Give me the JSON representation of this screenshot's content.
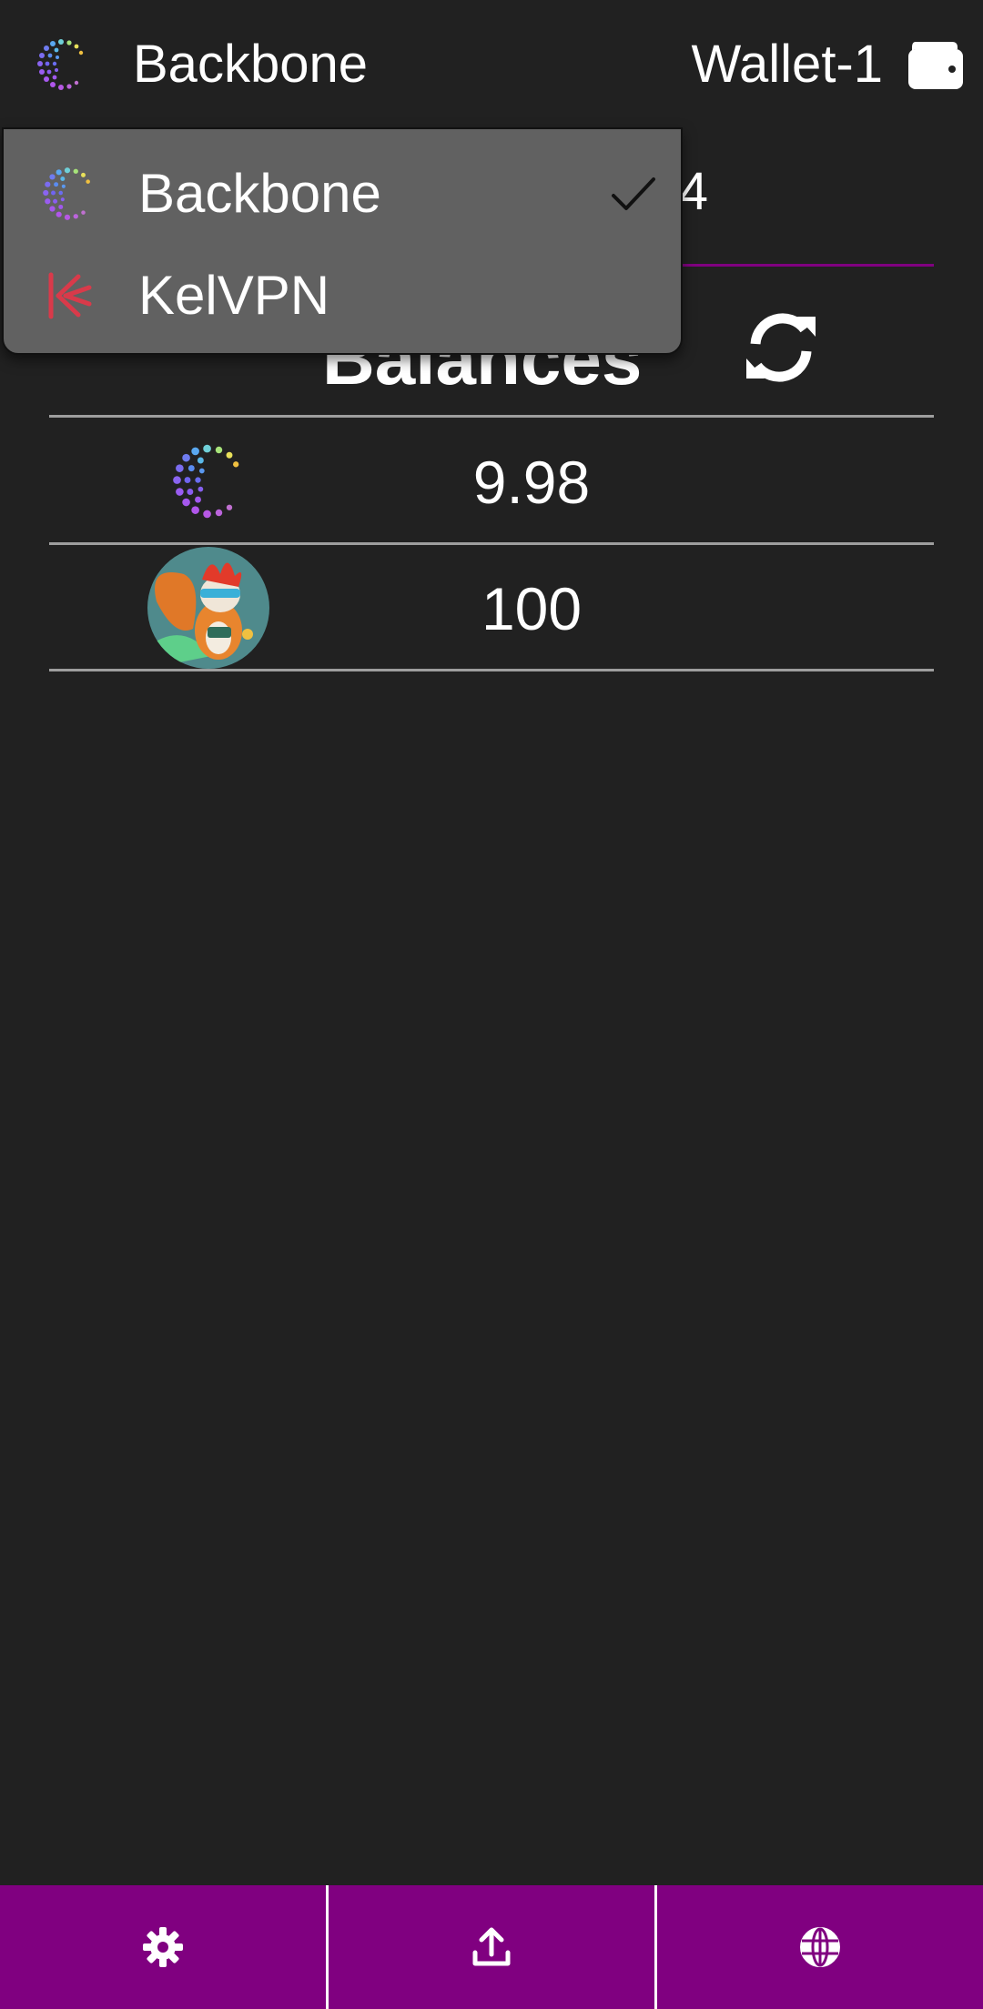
{
  "header": {
    "network_name": "Backbone",
    "network_icon": "backbone-logo-icon",
    "wallet_name": "Wallet-1",
    "wallet_icon": "wallet-icon"
  },
  "address": {
    "visible_fragment": "4"
  },
  "balances": {
    "title": "Balances",
    "refresh_icon": "refresh-icon",
    "rows": [
      {
        "token_icon": "backbone-token-icon",
        "amount": "9.98"
      },
      {
        "token_icon": "squirrel-token-icon",
        "amount": "100"
      }
    ]
  },
  "network_menu": {
    "items": [
      {
        "label": "Backbone",
        "icon": "backbone-logo-icon",
        "selected": true
      },
      {
        "label": "KelVPN",
        "icon": "kelvpn-logo-icon",
        "selected": false
      }
    ]
  },
  "bottom_nav": {
    "items": [
      {
        "icon": "gear-icon"
      },
      {
        "icon": "upload-icon"
      },
      {
        "icon": "globe-icon"
      }
    ]
  },
  "colors": {
    "background": "#212121",
    "accent": "#800080",
    "menu_background": "#616161",
    "divider": "#9e9e9e",
    "kelvpn_red": "#d93a4a"
  }
}
